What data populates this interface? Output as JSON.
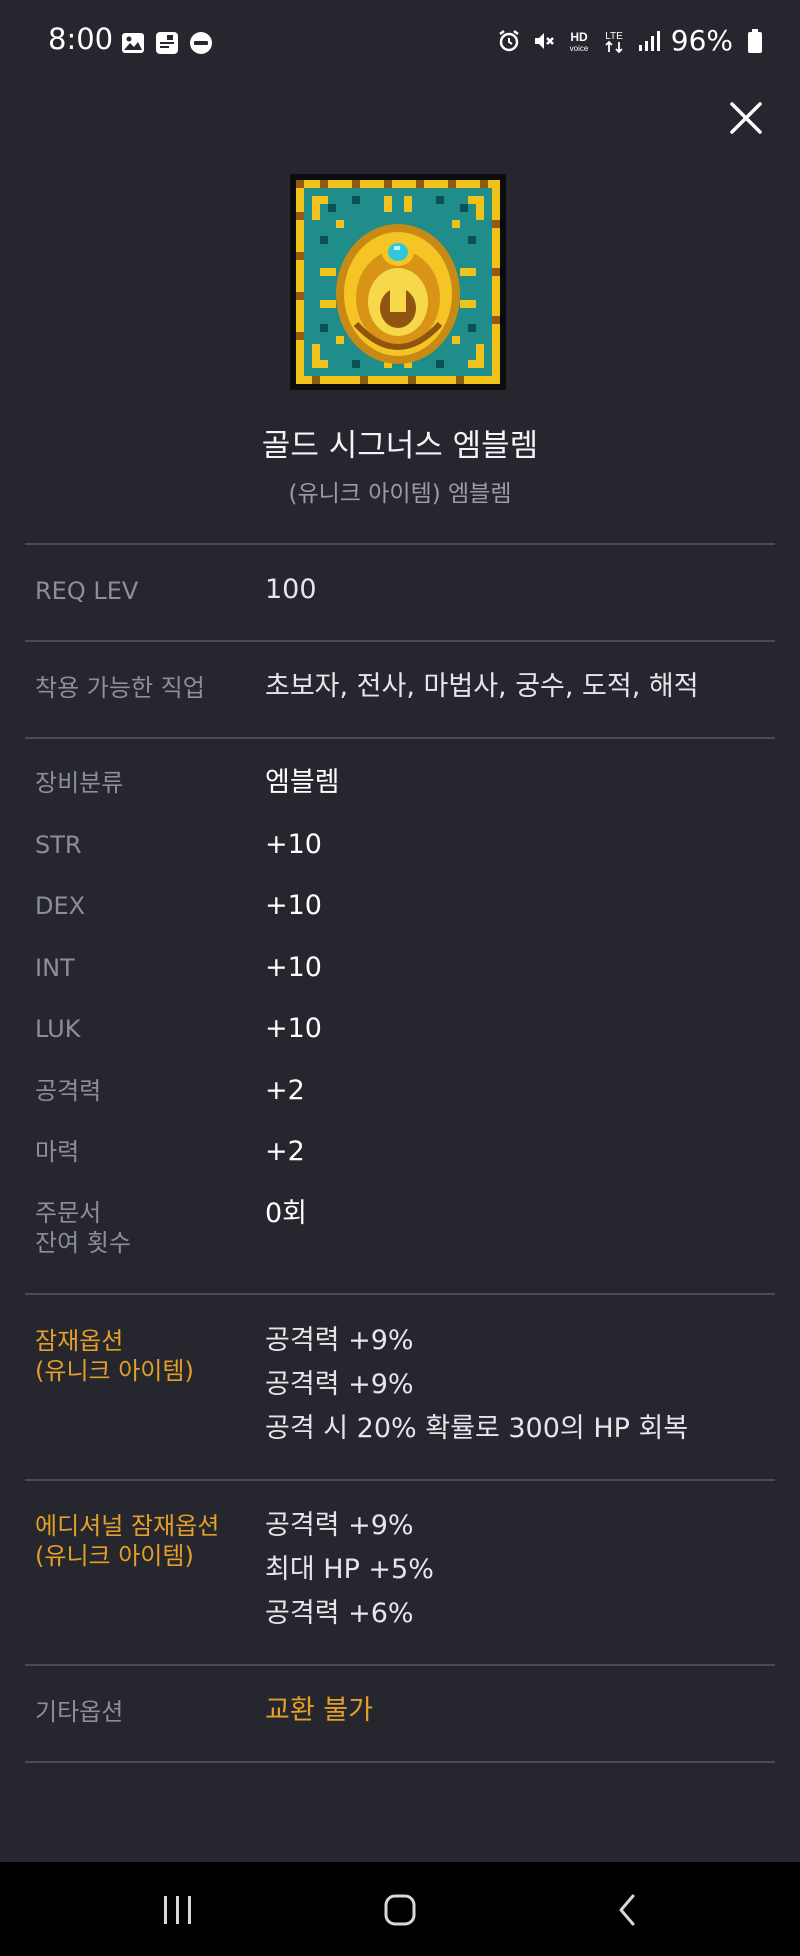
{
  "status_bar": {
    "time": "8:00",
    "battery": "96%",
    "left_icons": [
      "image-icon",
      "pay-icon",
      "wear-icon"
    ],
    "right_icons": [
      "alarm-icon",
      "mute-icon",
      "hd-voice-icon",
      "lte-icon",
      "signal-icon",
      "battery-icon"
    ]
  },
  "item": {
    "name": "골드 시그너스 엠블렘",
    "subtitle": "(유니크 아이템) 엠블렘"
  },
  "rows": {
    "req_lev": {
      "label": "REQ LEV",
      "value": "100"
    },
    "jobs": {
      "label": "착용 가능한 직업",
      "value": "초보자, 전사, 마법사, 궁수, 도적, 해적"
    },
    "category": {
      "label": "장비분류",
      "value": "엠블렘"
    },
    "str": {
      "label": "STR",
      "value": "+10"
    },
    "dex": {
      "label": "DEX",
      "value": "+10"
    },
    "int": {
      "label": "INT",
      "value": "+10"
    },
    "luk": {
      "label": "LUK",
      "value": "+10"
    },
    "attack": {
      "label": "공격력",
      "value": "+2"
    },
    "magic": {
      "label": "마력",
      "value": "+2"
    },
    "scroll": {
      "label_line1": "주문서",
      "label_line2": "잔여 횟수",
      "value": "0회"
    }
  },
  "potential": {
    "label_line1": "잠재옵션",
    "label_line2": "(유니크 아이템)",
    "lines": [
      "공격력 +9%",
      "공격력 +9%",
      "공격 시 20% 확률로 300의 HP 회복"
    ]
  },
  "additional_potential": {
    "label_line1": "에디셔널 잠재옵션",
    "label_line2": "(유니크 아이템)",
    "lines": [
      "공격력 +9%",
      "최대 HP +5%",
      "공격력 +6%"
    ]
  },
  "other": {
    "label": "기타옵션",
    "value": "교환 불가"
  },
  "colors": {
    "background": "#25262e",
    "gold": "#e39f27",
    "label_gray": "#8d8e96",
    "divider": "#4a4b53"
  }
}
